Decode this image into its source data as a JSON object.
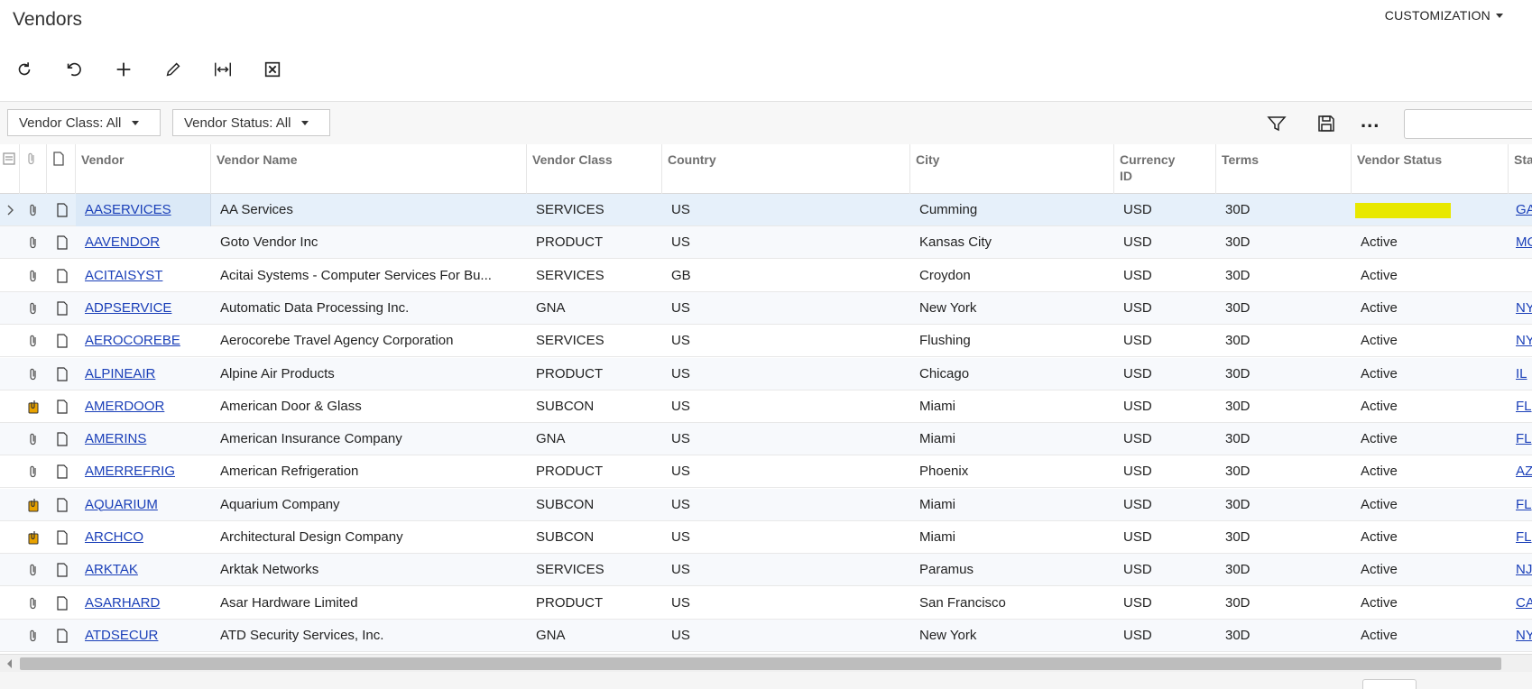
{
  "page": {
    "title": "Vendors",
    "customization_label": "CUSTOMIZATION"
  },
  "toolbar": {
    "buttons": [
      "refresh-icon",
      "undo-icon",
      "add-icon",
      "edit-icon",
      "fit-columns-icon",
      "export-excel-icon"
    ]
  },
  "filters": {
    "vendor_class": "Vendor Class: All",
    "vendor_status": "Vendor Status: All",
    "more": "...",
    "search_value": ""
  },
  "columns": {
    "vendor": "Vendor",
    "vendor_name": "Vendor Name",
    "vendor_class": "Vendor Class",
    "country": "Country",
    "city": "City",
    "currency_l1": "Currency",
    "currency_l2": "ID",
    "terms": "Terms",
    "vendor_status": "Vendor Status",
    "state": "Sta"
  },
  "rows": [
    {
      "id": "AASERVICES",
      "name": "AA Services",
      "cls": "SERVICES",
      "country": "US",
      "city": "Cumming",
      "cur": "USD",
      "terms": "30D",
      "status": "",
      "state": "GA",
      "files": false
    },
    {
      "id": "AAVENDOR",
      "name": "Goto Vendor Inc",
      "cls": "PRODUCT",
      "country": "US",
      "city": "Kansas City",
      "cur": "USD",
      "terms": "30D",
      "status": "Active",
      "state": "MO",
      "files": false
    },
    {
      "id": "ACITAISYST",
      "name": "Acitai Systems - Computer Services For Bu...",
      "cls": "SERVICES",
      "country": "GB",
      "city": "Croydon",
      "cur": "USD",
      "terms": "30D",
      "status": "Active",
      "state": "",
      "files": false
    },
    {
      "id": "ADPSERVICE",
      "name": "Automatic Data Processing Inc.",
      "cls": "GNA",
      "country": "US",
      "city": "New York",
      "cur": "USD",
      "terms": "30D",
      "status": "Active",
      "state": "NY",
      "files": false
    },
    {
      "id": "AEROCOREBE",
      "name": "Aerocorebe Travel Agency Corporation",
      "cls": "SERVICES",
      "country": "US",
      "city": "Flushing",
      "cur": "USD",
      "terms": "30D",
      "status": "Active",
      "state": "NY",
      "files": false
    },
    {
      "id": "ALPINEAIR",
      "name": "Alpine Air Products",
      "cls": "PRODUCT",
      "country": "US",
      "city": "Chicago",
      "cur": "USD",
      "terms": "30D",
      "status": "Active",
      "state": "IL",
      "files": false
    },
    {
      "id": "AMERDOOR",
      "name": "American Door & Glass",
      "cls": "SUBCON",
      "country": "US",
      "city": "Miami",
      "cur": "USD",
      "terms": "30D",
      "status": "Active",
      "state": "FL",
      "files": true
    },
    {
      "id": "AMERINS",
      "name": "American Insurance Company",
      "cls": "GNA",
      "country": "US",
      "city": "Miami",
      "cur": "USD",
      "terms": "30D",
      "status": "Active",
      "state": "FL",
      "files": false
    },
    {
      "id": "AMERREFRIG",
      "name": "American Refrigeration",
      "cls": "PRODUCT",
      "country": "US",
      "city": "Phoenix",
      "cur": "USD",
      "terms": "30D",
      "status": "Active",
      "state": "AZ",
      "files": false
    },
    {
      "id": "AQUARIUM",
      "name": "Aquarium Company",
      "cls": "SUBCON",
      "country": "US",
      "city": "Miami",
      "cur": "USD",
      "terms": "30D",
      "status": "Active",
      "state": "FL",
      "files": true
    },
    {
      "id": "ARCHCO",
      "name": "Architectural Design Company",
      "cls": "SUBCON",
      "country": "US",
      "city": "Miami",
      "cur": "USD",
      "terms": "30D",
      "status": "Active",
      "state": "FL",
      "files": true
    },
    {
      "id": "ARKTAK",
      "name": "Arktak Networks",
      "cls": "SERVICES",
      "country": "US",
      "city": "Paramus",
      "cur": "USD",
      "terms": "30D",
      "status": "Active",
      "state": "NJ",
      "files": false
    },
    {
      "id": "ASARHARD",
      "name": "Asar Hardware Limited",
      "cls": "PRODUCT",
      "country": "US",
      "city": "San Francisco",
      "cur": "USD",
      "terms": "30D",
      "status": "Active",
      "state": "CA",
      "files": false
    },
    {
      "id": "ATDSECUR",
      "name": "ATD Security Services, Inc.",
      "cls": "GNA",
      "country": "US",
      "city": "New York",
      "cur": "USD",
      "terms": "30D",
      "status": "Active",
      "state": "NY",
      "files": false
    }
  ],
  "colors": {
    "link": "#1a3fb8",
    "selected_row": "#e6f0fa",
    "highlight": "#e8e800",
    "files_badge": "#e8a200"
  }
}
